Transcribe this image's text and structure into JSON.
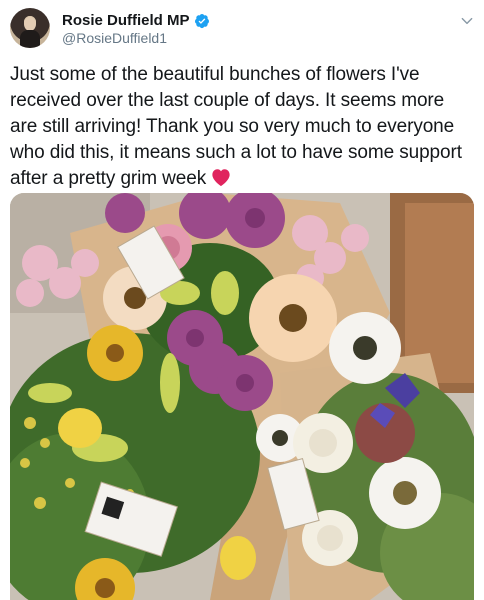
{
  "author": {
    "name": "Rosie Duffield MP",
    "handle": "@RosieDuffield1",
    "verified": true,
    "avatar_icon": "profile-photo"
  },
  "tweet": {
    "text": "Just some of the beautiful bunches of flowers I've received over the last couple of days. It seems more are still arriving! Thank you so very much to everyone who did this, it means such a lot to have some support after a pretty grim week",
    "emoji": "red-heart-icon"
  },
  "media": {
    "subject": "photo-flower-bouquets"
  },
  "colors": {
    "verified_blue": "#1da1f2",
    "heart_red": "#e0245e",
    "handle_gray": "#657786"
  }
}
